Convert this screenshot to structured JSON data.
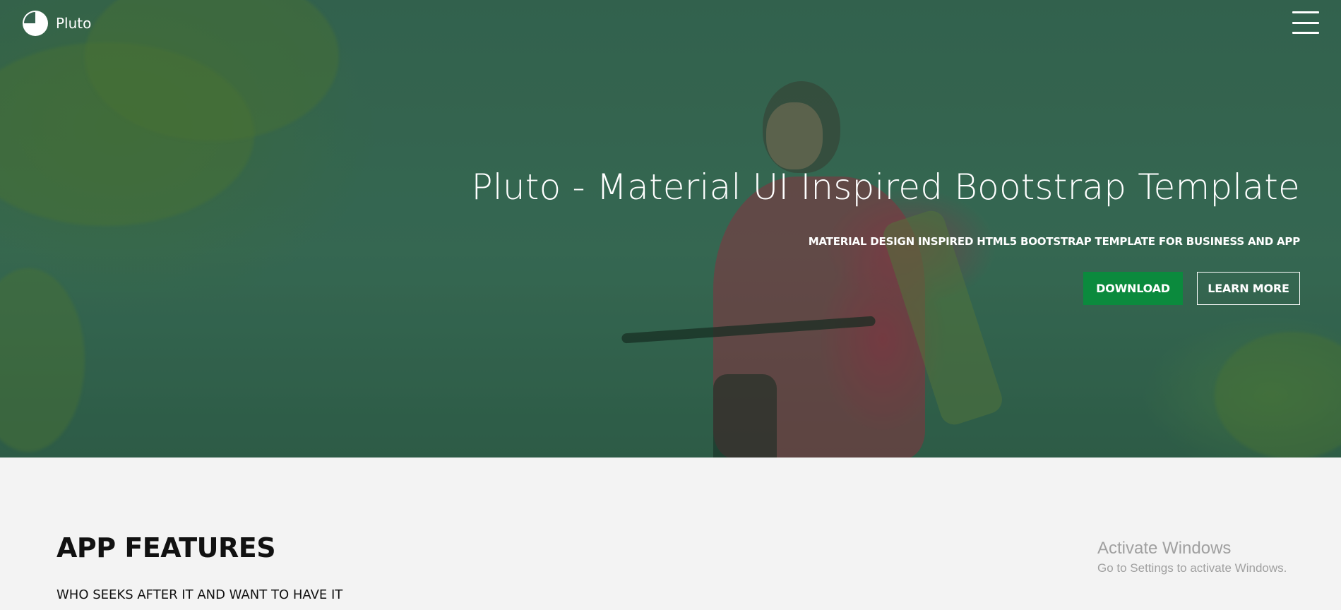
{
  "brand": {
    "name": "Pluto",
    "logo_icon": "pie-logo-icon"
  },
  "nav": {
    "menu_icon": "hamburger-menu-icon"
  },
  "hero": {
    "title": "Pluto - Material UI Inspired Bootstrap Template",
    "subtitle": "MATERIAL DESIGN INSPIRED HTML5 BOOTSTRAP TEMPLATE FOR BUSINESS AND APP",
    "download_label": "DOWNLOAD",
    "learn_more_label": "LEARN MORE"
  },
  "features": {
    "title": "APP FEATURES",
    "subtitle": "WHO SEEKS AFTER IT AND WANT TO HAVE IT"
  },
  "watermark": {
    "title": "Activate Windows",
    "subtitle": "Go to Settings to activate Windows."
  },
  "colors": {
    "hero_overlay": "#36624f",
    "download_button": "#0b8a3d",
    "section_background": "#f3f3f3",
    "text_dark": "#111111"
  }
}
